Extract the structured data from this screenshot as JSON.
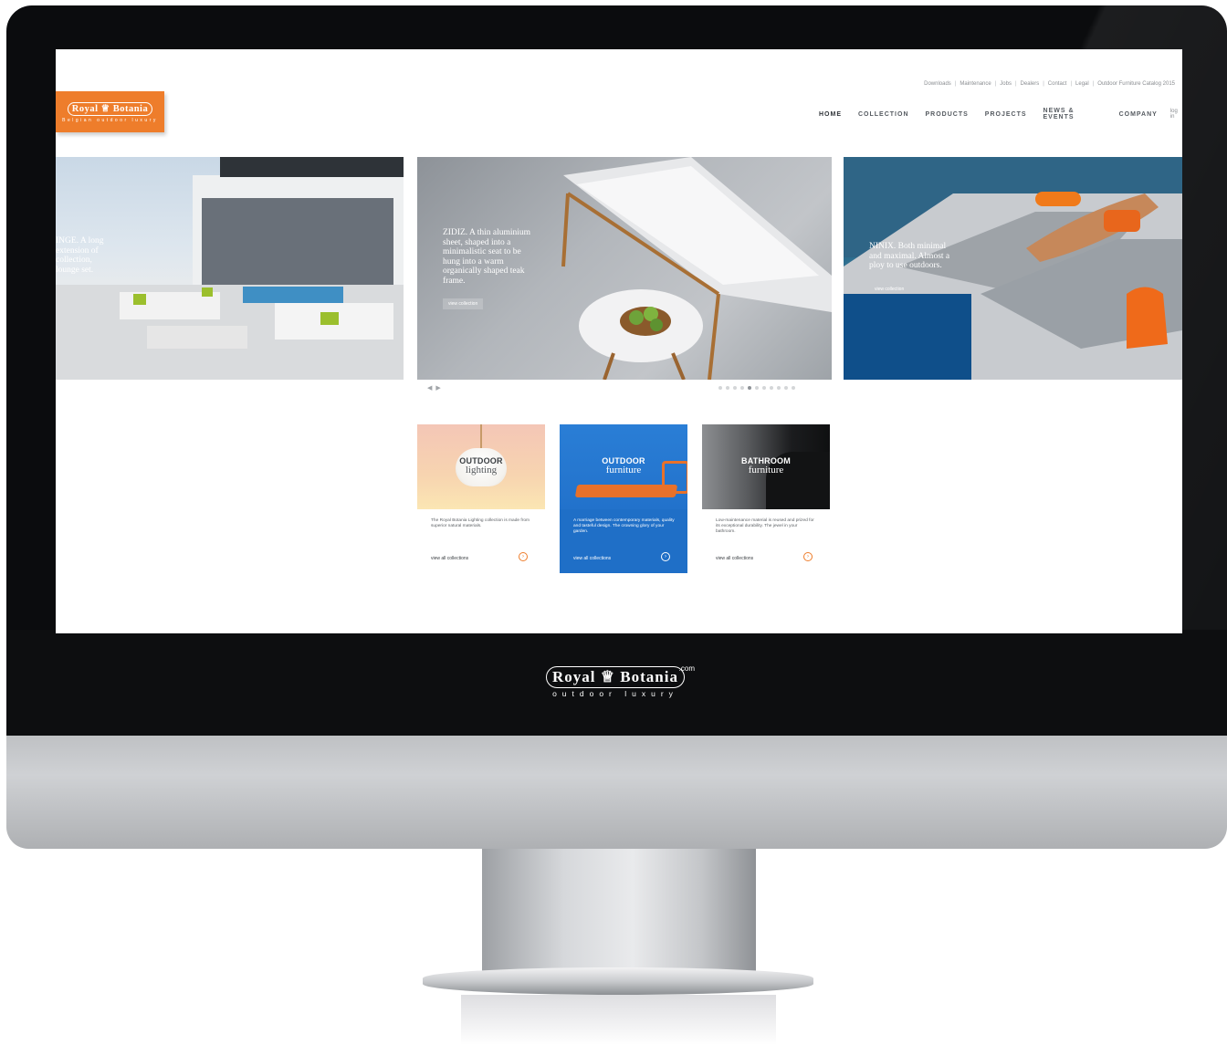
{
  "brand": {
    "word_left": "Royal",
    "word_right": "Botania",
    "header_tagline": "Belgian outdoor luxury",
    "monitor_tagline": "outdoor luxury",
    "dotcom": ".com",
    "accent_color": "#ee7d2b"
  },
  "utility_links": [
    "Downloads",
    "Maintenance",
    "Jobs",
    "Dealers",
    "Contact",
    "Legal",
    "Outdoor Furniture Catalog 2015"
  ],
  "nav": {
    "items": [
      "HOME",
      "COLLECTION",
      "PRODUCTS",
      "PROJECTS",
      "NEWS & EVENTS",
      "COMPANY"
    ],
    "active": "HOME",
    "login": "log in"
  },
  "slides": [
    {
      "caption_lines": [
        "INGE. A long",
        "extension of",
        "collection,",
        "lounge set."
      ]
    },
    {
      "caption_lines": [
        "ZIDIZ. A thin aluminium",
        "sheet, shaped into a",
        "minimalistic seat to be",
        "hung into a warm",
        "organically shaped teak",
        "frame."
      ],
      "button": "view collection"
    },
    {
      "caption_lines": [
        "NINIX. Both minimal",
        "and maximal. Almost a",
        "ploy to use outdoors."
      ],
      "button": "view collection"
    }
  ],
  "slider": {
    "prev_next": "◀ ▶",
    "dot_count": 11,
    "active_dot": 4
  },
  "cards": [
    {
      "title_top": "OUTDOOR",
      "title_bottom": "lighting",
      "desc": "The Royal Botania Lighting collection is made from superior natural materials.",
      "link": "view all collections"
    },
    {
      "title_top": "OUTDOOR",
      "title_bottom": "furniture",
      "desc": "A marriage between contemporary materials, quality and tasteful design. The crowning glory of your garden.",
      "link": "view all collections"
    },
    {
      "title_top": "BATHROOM",
      "title_bottom": "furniture",
      "desc": "Low-maintenance material is reused and prized for its exceptional durability. The jewel in your bathroom.",
      "link": "view all collections"
    }
  ],
  "icons": {
    "card_arrow": "arrow-right-circle-icon"
  }
}
